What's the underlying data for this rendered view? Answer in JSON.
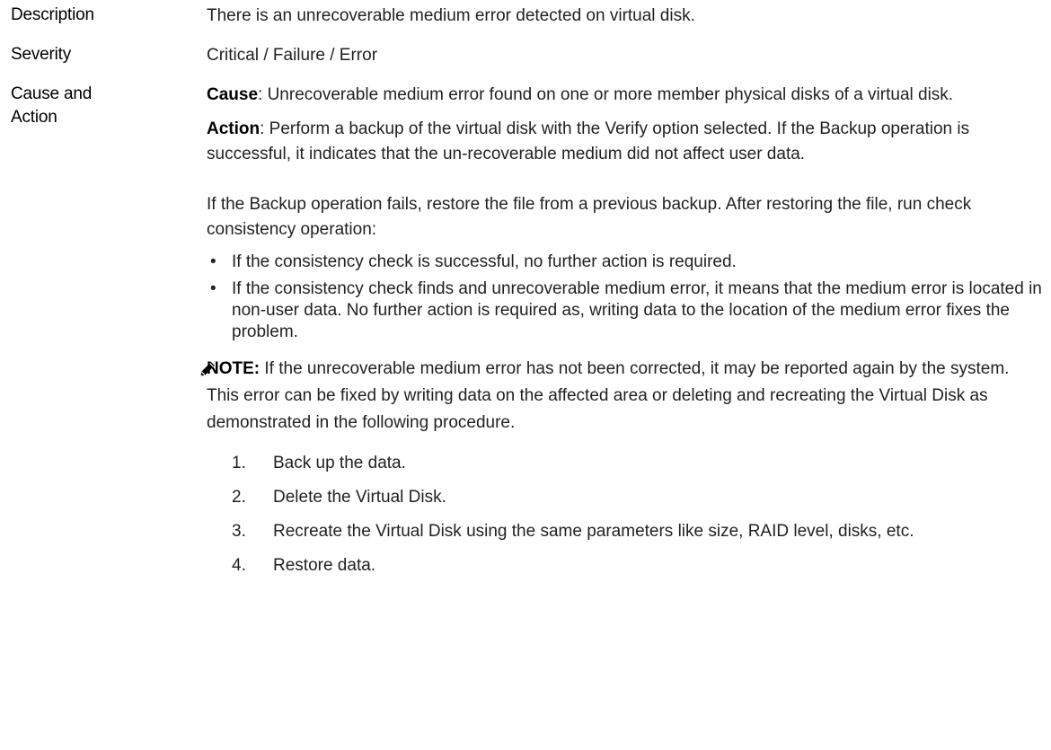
{
  "description": {
    "label": "Description",
    "text": "There is an unrecoverable medium error detected on virtual disk."
  },
  "severity": {
    "label": "Severity",
    "text": "Critical / Failure / Error"
  },
  "cause_action": {
    "label_line1": "Cause and",
    "label_line2": "Action",
    "cause_head": "Cause",
    "cause_text": ": Unrecoverable medium error found on one or more member physical disks of a virtual disk.",
    "action_head": "Action",
    "action_text": ": Perform a backup of the virtual disk with the Verify option selected. If the Backup operation is successful, it indicates that the un-recoverable medium did not affect user data.",
    "backup_fails_text": "If the Backup operation fails, restore the file from a previous backup. After restoring the file, run check consistency operation:",
    "bullet_char": "•",
    "bullets": [
      "If the consistency check is successful, no further action is required.",
      "If the consistency check finds and unrecoverable medium error, it means that the medium error is located in non-user data. No further action is required as, writing data to the location of the medium error fixes the problem."
    ],
    "note": {
      "icon": "pencil-note-icon",
      "head": "NOTE:",
      "text": " If the unrecoverable medium error has not been corrected, it may be reported again by the system. This error can be fixed by writing data on the affected area or deleting and recreating the Virtual Disk as demonstrated in the following procedure."
    },
    "steps": [
      {
        "num": "1.",
        "text": "Back up the data."
      },
      {
        "num": "2.",
        "text": "Delete the Virtual Disk."
      },
      {
        "num": "3.",
        "text": "Recreate the Virtual Disk using the same parameters like size, RAID level, disks, etc."
      },
      {
        "num": "4.",
        "text": "Restore data."
      }
    ]
  }
}
